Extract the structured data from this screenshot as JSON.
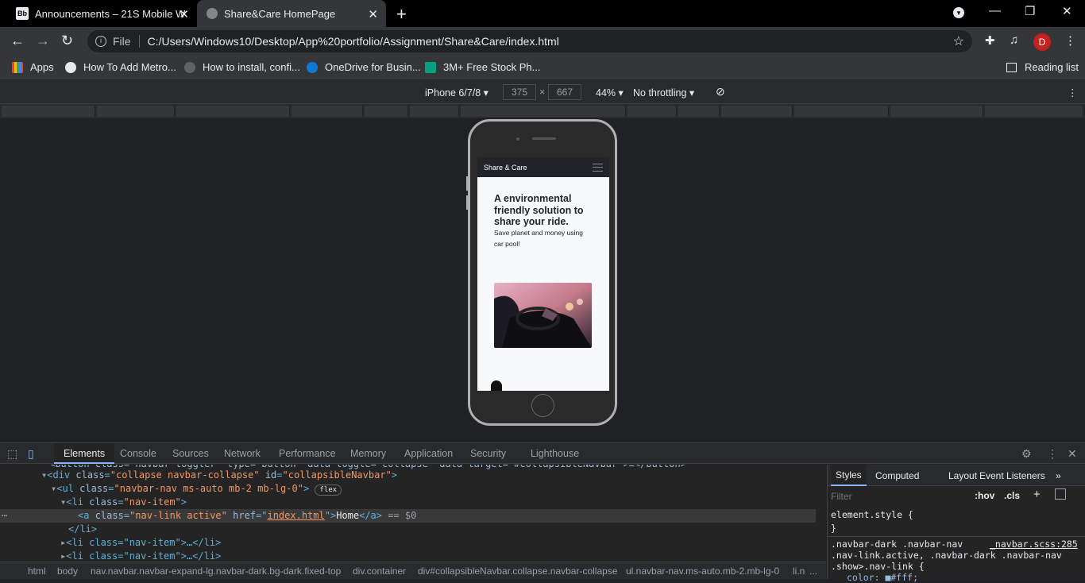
{
  "browser": {
    "tabs": [
      {
        "title": "Announcements – 21S Mobile W",
        "favicon": "Bb"
      },
      {
        "title": "Share&Care HomePage"
      }
    ],
    "scheme": "File",
    "url": "C:/Users/Windows10/Desktop/App%20portfolio/Assignment/Share&Care/index.html",
    "profile_initial": "D",
    "bookmarks": [
      "Apps",
      "How To Add Metro...",
      "How to install, confi...",
      "OneDrive for Busin...",
      "3M+ Free Stock Ph..."
    ],
    "reading_list": "Reading list"
  },
  "device_toolbar": {
    "device": "iPhone 6/7/8",
    "width": "375",
    "height": "667",
    "times": "×",
    "zoom": "44%",
    "throttling": "No throttling"
  },
  "page": {
    "brand": "Share & Care",
    "hero_title": "A environmental friendly solution to share your ride.",
    "hero_sub": "Save planet and money using car pool!"
  },
  "devtools": {
    "tabs": [
      "Elements",
      "Console",
      "Sources",
      "Network",
      "Performance",
      "Memory",
      "Application",
      "Security",
      "Lighthouse"
    ],
    "dom": {
      "l0": "<button class=\"navbar-toggler\" type=\"button\" data-toggle=\"collapse\" data-target=\"#collapsibleNavbar\">≡</button>",
      "l1_tag": "div",
      "l1_a1": "class",
      "l1_v1": "\"collapse navbar-collapse\"",
      "l1_a2": "id",
      "l1_v2": "\"collapsibleNavbar\"",
      "l2_tag": "ul",
      "l2_a1": "class",
      "l2_v1": "\"navbar-nav ms-auto mb-2 mb-lg-0\"",
      "l2_badge": "flex",
      "l3_tag": "li",
      "l3_a1": "class",
      "l3_v1": "\"nav-item\"",
      "l4_tag": "a",
      "l4_a1": "class",
      "l4_v1": "\"nav-link active\"",
      "l4_a2": "href",
      "l4_v2": "index.html",
      "l4_text": "Home",
      "l4_suffix": "== $0",
      "l5_tag": "/li",
      "l6": "<li class=\"nav-item\">…</li>",
      "l7": "<li class=\"nav-item\">…</li>"
    },
    "breadcrumb": [
      "html",
      "body",
      "nav.navbar.navbar-expand-lg.navbar-dark.bg-dark.fixed-top",
      "div.container",
      "div#collapsibleNavbar.collapse.navbar-collapse",
      "ul.navbar-nav.ms-auto.mb-2.mb-lg-0",
      "li.n",
      "..."
    ],
    "styles_tabs": [
      "Styles",
      "Computed",
      "Layout",
      "Event Listeners",
      "»"
    ],
    "filter_placeholder": "Filter",
    "hov": ":hov",
    "cls": ".cls",
    "rules": {
      "element_style": "element.style {",
      "close": "}",
      "selector": ".navbar-dark .navbar-nav\n.nav-link.active, .navbar-dark .navbar-nav\n.show>.nav-link {",
      "source": "_navbar.scss:285",
      "prop": "color: ■#fff;"
    }
  }
}
